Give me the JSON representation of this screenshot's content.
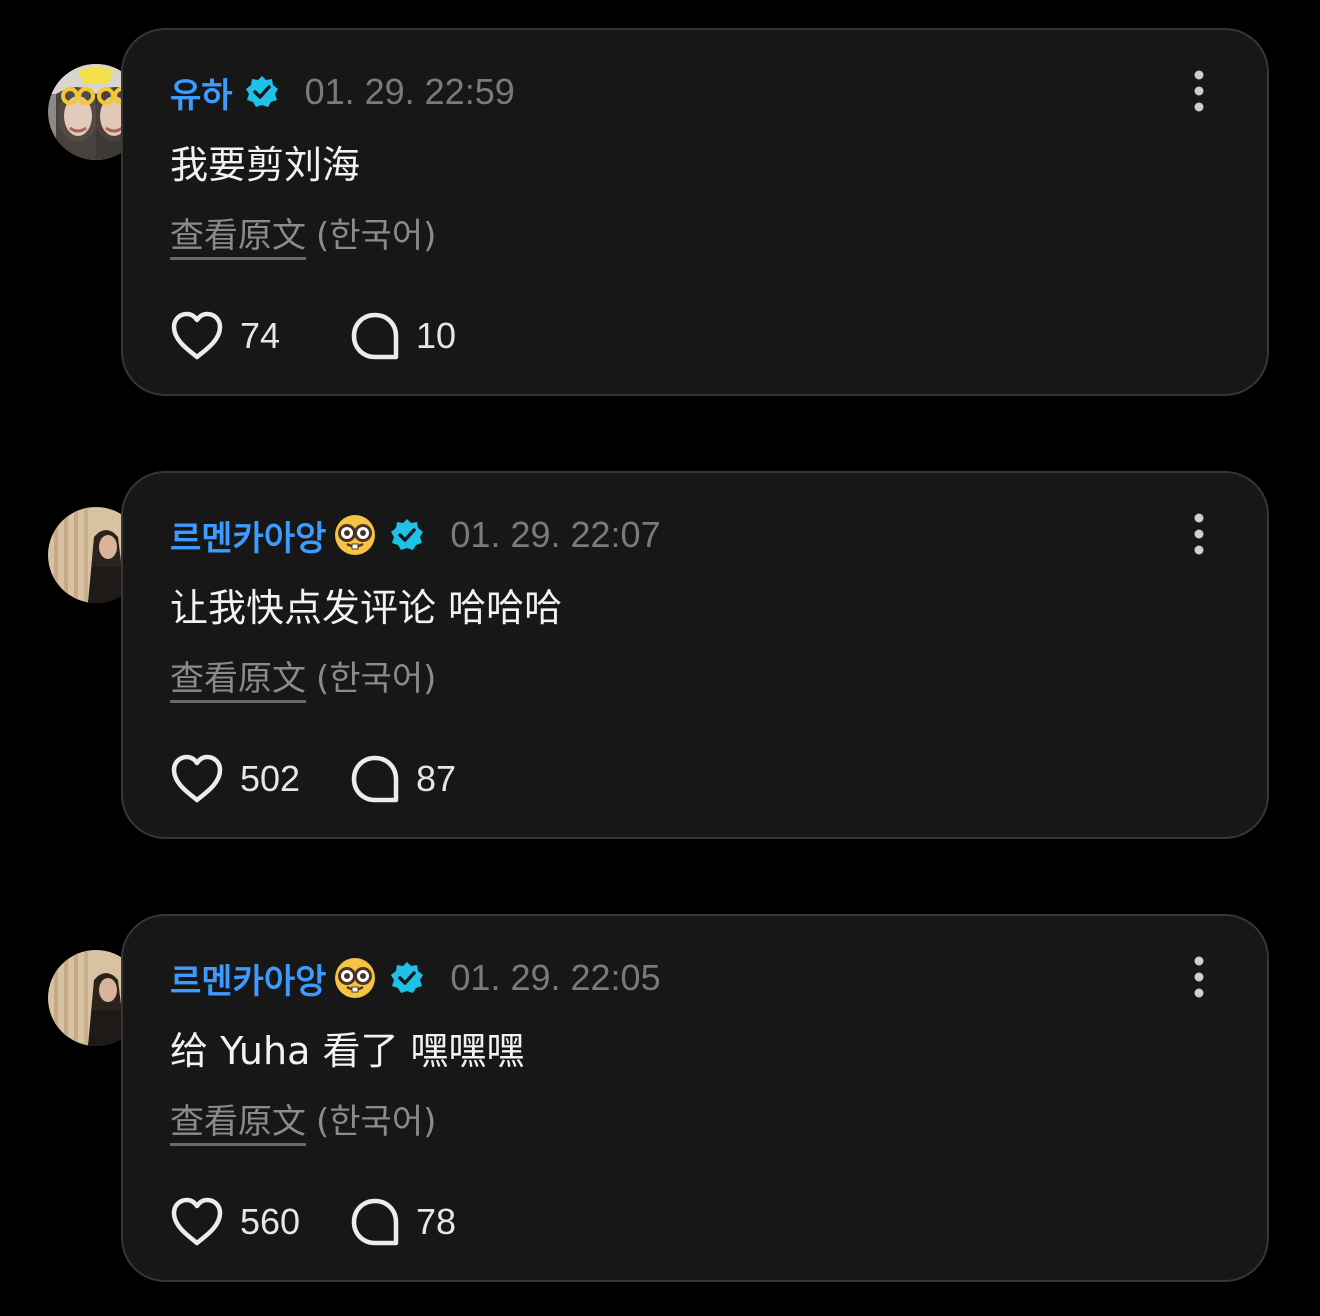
{
  "colors": {
    "background": "#000000",
    "card": "#171717",
    "card_border": "#363636",
    "username": "#3d9bff",
    "verified_badge": "#20c1e8",
    "timestamp": "#7a7a7a",
    "muted": "#8b8b8b"
  },
  "icons": {
    "verified": "verified-badge-icon",
    "more": "more-vertical-icon",
    "like": "heart-icon",
    "reply": "comment-bubble-icon",
    "emoji": "nerd-face-emoji"
  },
  "comments": [
    {
      "username": "유하",
      "timestamp": "01. 29. 22:59",
      "text": "我要剪刘海",
      "translate_link": "查看原文",
      "translate_lang": "(한국어)",
      "likes": "74",
      "replies": "10"
    },
    {
      "username": "르멘카아앙",
      "timestamp": "01. 29. 22:07",
      "text": "让我快点发评论 哈哈哈",
      "translate_link": "查看原文",
      "translate_lang": "(한국어)",
      "likes": "502",
      "replies": "87"
    },
    {
      "username": "르멘카아앙",
      "timestamp": "01. 29. 22:05",
      "text": "给 Yuha 看了 嘿嘿嘿",
      "translate_link": "查看原文",
      "translate_lang": "(한국어)",
      "likes": "560",
      "replies": "78"
    }
  ]
}
